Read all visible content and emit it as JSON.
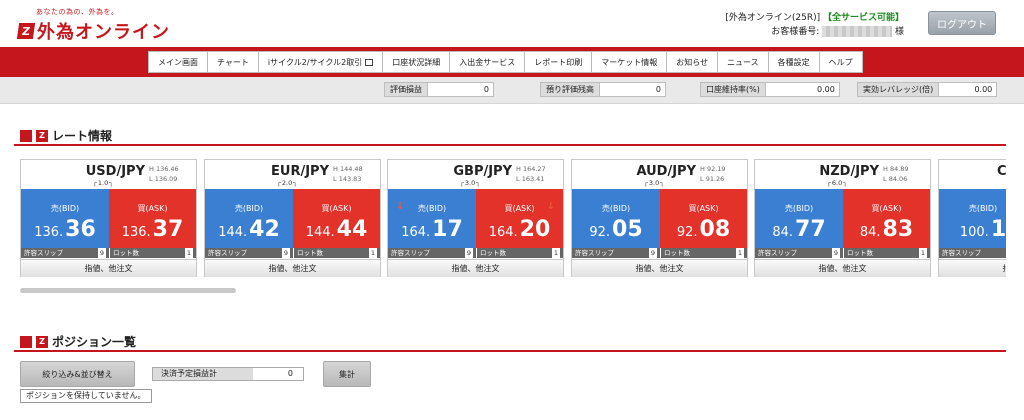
{
  "header": {
    "tagline": "あなたの為の、外為を。",
    "logo_mark": "Z",
    "logo_text": "外為オンライン",
    "service_name": "[外為オンライン(25R)]",
    "service_status": "【全サービス可能】",
    "account_label": "お客様番号:",
    "account_suffix": "様",
    "logout_label": "ログアウト"
  },
  "nav": {
    "items": [
      {
        "label": "メイン画面"
      },
      {
        "label": "チャート"
      },
      {
        "label": "iサイクル2/サイクル2取引"
      },
      {
        "label": "口座状況詳細"
      },
      {
        "label": "入出金サービス"
      },
      {
        "label": "レポート印刷"
      },
      {
        "label": "マーケット情報"
      },
      {
        "label": "お知らせ"
      },
      {
        "label": "ニュース"
      },
      {
        "label": "各種設定"
      },
      {
        "label": "ヘルプ"
      }
    ]
  },
  "summary": [
    {
      "label": "評価損益",
      "value": "0"
    },
    {
      "label": "預り評価残高",
      "value": "0"
    },
    {
      "label": "口座維持率(%)",
      "value": "0.00"
    },
    {
      "label": "実効レバレッジ(倍)",
      "value": "0.00"
    }
  ],
  "rates": {
    "title": "レート情報",
    "bid_label": "売(BID)",
    "ask_label": "買(ASK)",
    "slip_label": "許容スリップ",
    "lot_label": "ロット数",
    "order_label": "指値、他注文",
    "cards": [
      {
        "pair": "USD/JPY",
        "high": "H 136.46",
        "low": "L 136.09",
        "spread": "1.0",
        "bid_int": "136.",
        "bid_frac": "36",
        "ask_int": "136.",
        "ask_frac": "37",
        "slip": "9",
        "lot": "1",
        "arrow": ""
      },
      {
        "pair": "EUR/JPY",
        "high": "H 144.48",
        "low": "L 143.83",
        "spread": "2.0",
        "bid_int": "144.",
        "bid_frac": "42",
        "ask_int": "144.",
        "ask_frac": "44",
        "slip": "9",
        "lot": "1",
        "arrow": ""
      },
      {
        "pair": "GBP/JPY",
        "high": "H 164.27",
        "low": "L 163.41",
        "spread": "3.0",
        "bid_int": "164.",
        "bid_frac": "17",
        "ask_int": "164.",
        "ask_frac": "20",
        "slip": "9",
        "lot": "1",
        "arrow": "↓"
      },
      {
        "pair": "AUD/JPY",
        "high": "H 92.19",
        "low": "L 91.26",
        "spread": "3.0",
        "bid_int": "92.",
        "bid_frac": "05",
        "ask_int": "92.",
        "ask_frac": "08",
        "slip": "9",
        "lot": "1",
        "arrow": ""
      },
      {
        "pair": "NZD/JPY",
        "high": "H 84.89",
        "low": "L 84.06",
        "spread": "6.0",
        "bid_int": "84.",
        "bid_frac": "77",
        "ask_int": "84.",
        "ask_frac": "83",
        "slip": "9",
        "lot": "1",
        "arrow": ""
      },
      {
        "pair": "C",
        "high": "",
        "low": "",
        "spread": "",
        "bid_int": "100.",
        "bid_frac": "1",
        "ask_int": "",
        "ask_frac": "",
        "slip": "9",
        "lot": "",
        "arrow": ""
      }
    ]
  },
  "positions": {
    "title": "ポジション一覧",
    "filter_label": "絞り込み&並び替え",
    "pl_label": "決済予定損益計",
    "pl_value": "0",
    "sum_label": "集計",
    "empty_message": "ポジションを保持していません。"
  },
  "colors": {
    "brand": "#c4161c",
    "bid": "#3a7fd1",
    "ask": "#e2322a"
  }
}
